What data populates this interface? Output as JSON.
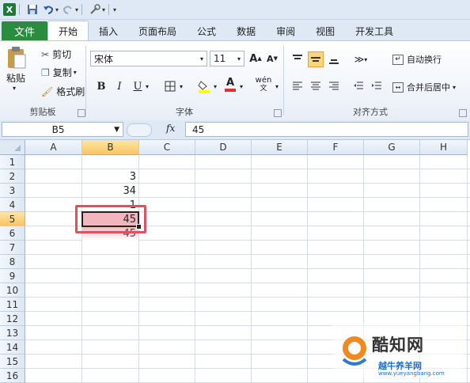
{
  "app": {
    "logo_letter": "X"
  },
  "tabs": [
    "文件",
    "开始",
    "插入",
    "页面布局",
    "公式",
    "数据",
    "审阅",
    "视图",
    "开发工具"
  ],
  "ribbon": {
    "clipboard": {
      "paste": "粘贴",
      "cut": "剪切",
      "copy": "复制",
      "format_painter": "格式刷",
      "group": "剪贴板"
    },
    "font": {
      "name": "宋体",
      "size": "11",
      "grow": "A",
      "shrink": "A",
      "bold": "B",
      "italic": "I",
      "underline": "U",
      "font_color_letter": "A",
      "phonetic": "wén",
      "group": "字体"
    },
    "alignment": {
      "wrap": "自动换行",
      "merge": "合并后居中",
      "group": "对齐方式"
    }
  },
  "formula_bar": {
    "name_box": "B5",
    "fx": "fx",
    "value": "45"
  },
  "columns": [
    "A",
    "B",
    "C",
    "D",
    "E",
    "F",
    "G",
    "H"
  ],
  "rows": [
    "1",
    "2",
    "3",
    "4",
    "5",
    "6",
    "7",
    "8",
    "9",
    "10",
    "11",
    "12",
    "13",
    "14",
    "15",
    "16"
  ],
  "active_cell": {
    "column": "B",
    "row": "5"
  },
  "cells": {
    "B2": "3",
    "B3": "34",
    "B4": "1",
    "B5": "45",
    "B6": "45"
  },
  "watermark": {
    "brand": "酷知网",
    "sub": "越牛养羊网",
    "url": "www.yueyangbang.com"
  },
  "colors": {
    "highlight_fill": "#f3b6be",
    "highlight_border": "#d9545f",
    "file_tab": "#2a8d3d"
  }
}
